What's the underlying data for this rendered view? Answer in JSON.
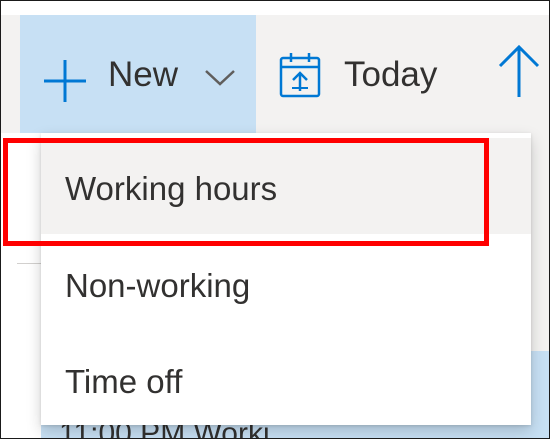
{
  "toolbar": {
    "new_label": "New",
    "today_label": "Today",
    "icons": {
      "new": "plus-icon",
      "new_dropdown": "chevron-down-icon",
      "today": "calendar-today-icon",
      "up": "arrow-up-icon"
    }
  },
  "menu": {
    "items": [
      {
        "label": "Working hours"
      },
      {
        "label": "Non-working"
      },
      {
        "label": "Time off"
      }
    ]
  },
  "background": {
    "partial_text": "11:00 PM  Worki..."
  },
  "colors": {
    "accent_selected": "#c7e0f4",
    "toolbar_bg": "#f3f2f1",
    "icon_blue": "#0078d4",
    "text": "#323130",
    "highlight": "#ff0000"
  }
}
